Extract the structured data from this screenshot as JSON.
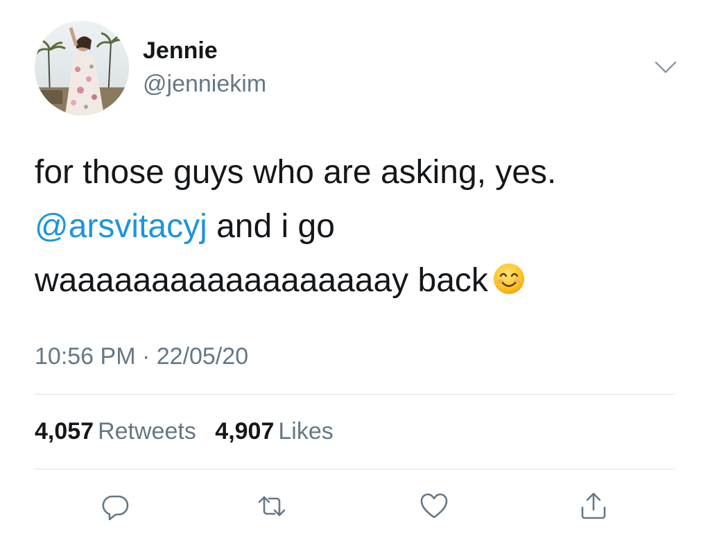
{
  "author": {
    "display_name": "Jennie",
    "handle": "@jenniekim"
  },
  "tweet": {
    "line1": "for those guys who are asking, yes.",
    "mention": "@arsvitacyj",
    "line2_rest": " and i go",
    "line3": "waaaaaaaaaaaaaaaaaay back",
    "emoji": "smiling-face-with-smiling-eyes"
  },
  "meta": {
    "time": "10:56 PM",
    "separator": " · ",
    "date": "22/05/20"
  },
  "stats": {
    "retweets_count": "4,057",
    "retweets_label": "Retweets",
    "likes_count": "4,907",
    "likes_label": "Likes"
  },
  "actions": [
    "reply-icon",
    "retweet-icon",
    "like-icon",
    "share-icon"
  ],
  "colors": {
    "text": "#14171a",
    "secondary": "#657786",
    "link": "#1b95e0",
    "divider": "#d9dee2",
    "icon": "#657786"
  }
}
